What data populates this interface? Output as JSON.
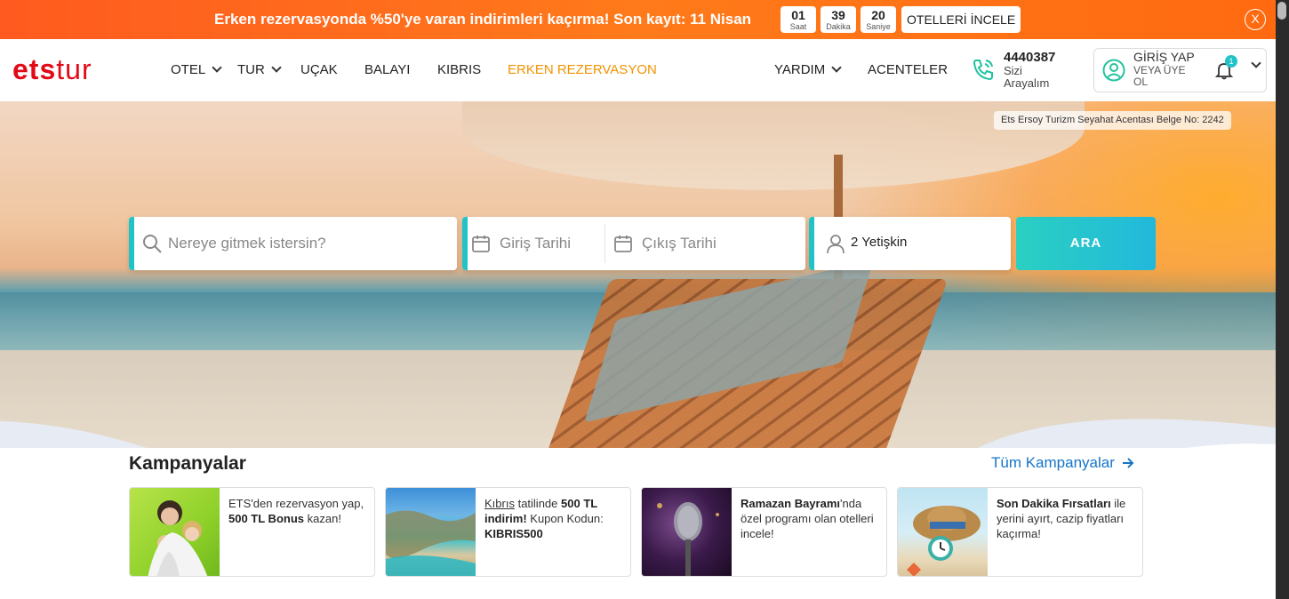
{
  "promo": {
    "text": "Erken rezervasyonda %50'ye varan indirimleri kaçırma! Son kayıt: 11 Nisan",
    "countdown": [
      {
        "value": "01",
        "unit": "Saat"
      },
      {
        "value": "39",
        "unit": "Dakika"
      },
      {
        "value": "20",
        "unit": "Saniye"
      }
    ],
    "button": "OTELLERİ İNCELE",
    "close": "X"
  },
  "header": {
    "logo_bold": "ets",
    "logo_thin": "tur",
    "nav": [
      {
        "label": "OTEL",
        "dropdown": true
      },
      {
        "label": "TUR",
        "dropdown": true
      },
      {
        "label": "UÇAK",
        "dropdown": false
      },
      {
        "label": "BALAYI",
        "dropdown": false
      },
      {
        "label": "KIBRIS",
        "dropdown": false
      },
      {
        "label": "ERKEN REZERVASYON",
        "dropdown": false,
        "highlight": true
      }
    ],
    "help": "YARDIM",
    "agencies": "ACENTELER",
    "phone": {
      "number": "4440387",
      "sub1": "Sizi",
      "sub2": "Arayalım"
    },
    "login": {
      "title": "GİRİŞ YAP",
      "sub1": "VEYA ÜYE",
      "sub2": "OL"
    },
    "notification_count": "1"
  },
  "hero": {
    "license": "Ets Ersoy Turizm Seyahat Acentası  Belge No: 2242"
  },
  "search": {
    "where_placeholder": "Nereye gitmek istersin?",
    "checkin": "Giriş Tarihi",
    "checkout": "Çıkış Tarihi",
    "guests": "2 Yetişkin",
    "button": "ARA"
  },
  "campaigns": {
    "title": "Kampanyalar",
    "all_link": "Tüm Kampanyalar",
    "cards": [
      {
        "t1": "ETS'den rezervasyon yap, ",
        "b1": "500 TL Bonus",
        "t2": " kazan!"
      },
      {
        "u1": "Kıbrıs",
        "t1": " tatilinde ",
        "b1": "500 TL indirim!",
        "t2": " Kupon Kodun: ",
        "b2": "KIBRIS500"
      },
      {
        "b1": "Ramazan Bayramı",
        "t1": "'nda özel programı olan otelleri incele!"
      },
      {
        "b1": "Son Dakika Fırsatları",
        "t1": " ile yerini ayırt, cazip fiyatları kaçırma!"
      }
    ]
  },
  "colors": {
    "brand_red": "#e30a17",
    "accent_orange": "#f39200",
    "accent_teal": "#22c3c8",
    "link_blue": "#1575c9"
  }
}
